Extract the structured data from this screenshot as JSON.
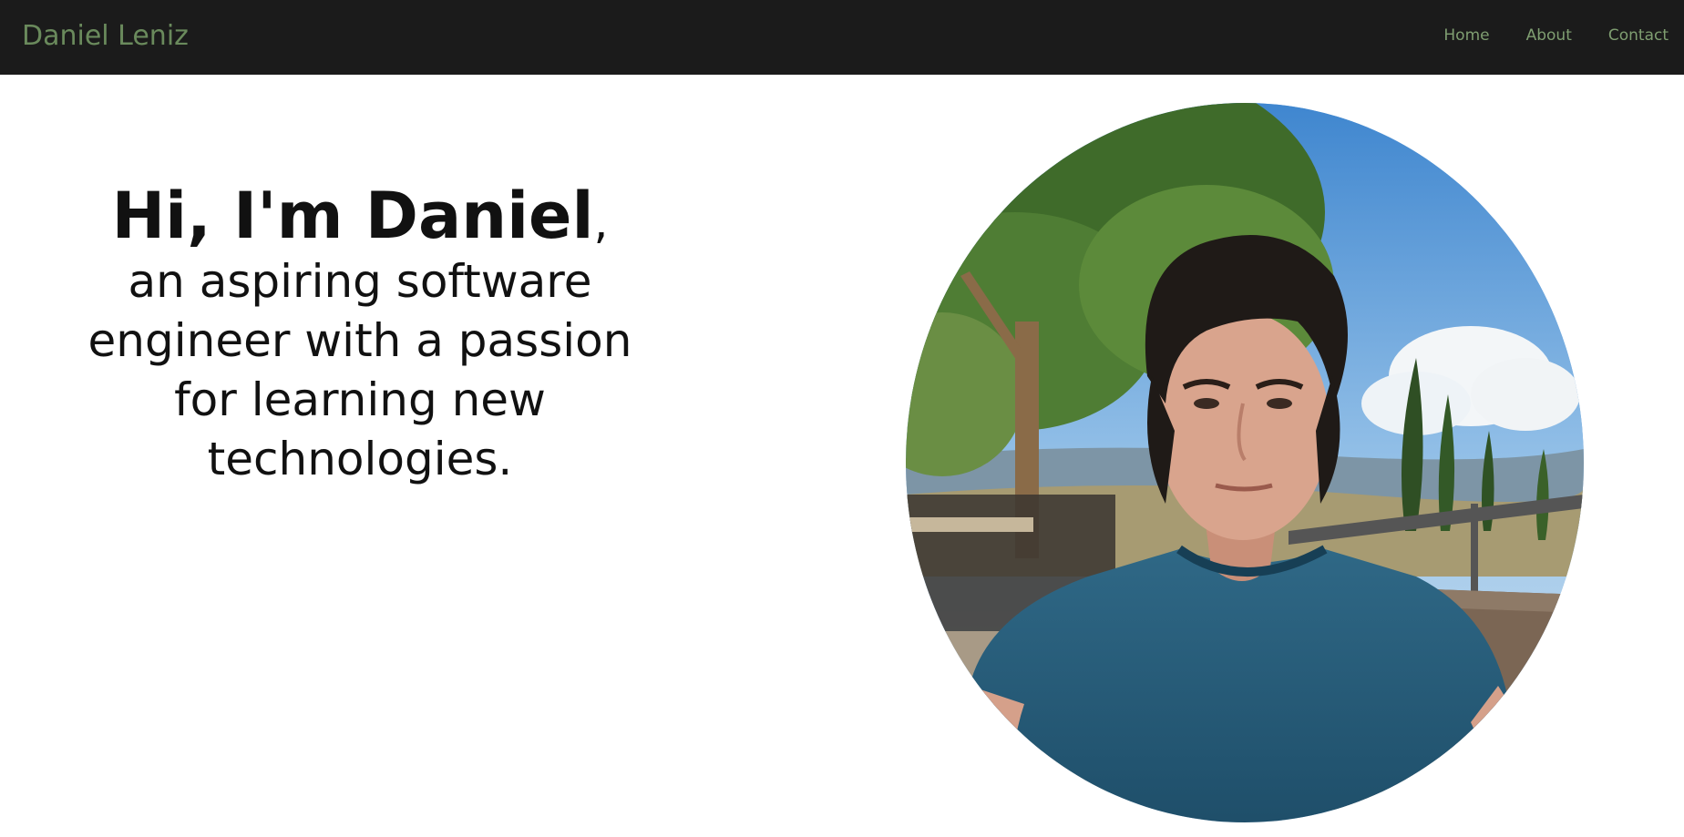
{
  "header": {
    "brand": "Daniel Leniz",
    "nav": [
      {
        "label": "Home"
      },
      {
        "label": "About"
      },
      {
        "label": "Contact"
      }
    ]
  },
  "hero": {
    "greeting_bold": "Hi, I'm Daniel",
    "greeting_rest": ", an aspiring software engineer with a passion for learning new technologies."
  },
  "colors": {
    "navbar_bg": "#1b1b1b",
    "brand_green": "#6a8a5c",
    "nav_green": "#7f9e71",
    "text": "#111111"
  }
}
